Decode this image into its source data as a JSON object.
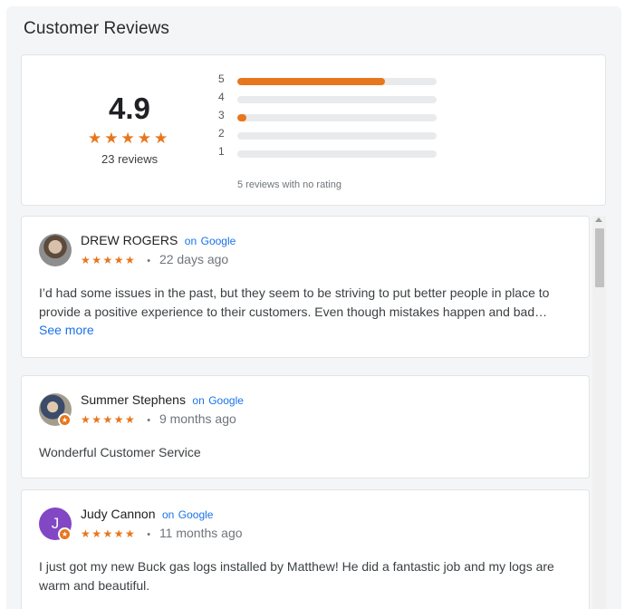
{
  "widget": {
    "title": "Customer Reviews"
  },
  "summary": {
    "rating": "4.9",
    "stars": "★★★★★",
    "review_count": "23 reviews",
    "no_rating_text": "5 reviews with no rating",
    "accent_color": "#e8761c",
    "distribution": [
      {
        "label": "5",
        "fraction": 0.74
      },
      {
        "label": "4",
        "fraction": 0.0
      },
      {
        "label": "3",
        "fraction": 0.045
      },
      {
        "label": "2",
        "fraction": 0.0
      },
      {
        "label": "1",
        "fraction": 0.0
      }
    ]
  },
  "reviews": [
    {
      "name": "DREW ROGERS",
      "on": "on",
      "source": "Google",
      "stars": "★★★★★",
      "separator": "•",
      "date": "22 days ago",
      "text": "I’d had some issues in the past, but they seem to be striving to put better people in place to provide a positive experience to their customers. Even though mistakes happen and bad…",
      "see_more": "See more",
      "avatar": "photo"
    },
    {
      "name": "Summer Stephens",
      "on": "on",
      "source": "Google",
      "stars": "★★★★★",
      "separator": "•",
      "date": "9 months ago",
      "text": "Wonderful Customer Service",
      "avatar": "photo",
      "badge_icon": "local-guide-star-icon"
    },
    {
      "name": "Judy Cannon",
      "on": "on",
      "source": "Google",
      "stars": "★★★★★",
      "separator": "•",
      "date": "11 months ago",
      "text": "I just got my new Buck gas logs installed by Matthew! He did a fantastic job and my logs are warm and beautiful.",
      "avatar_letter": "J",
      "avatar_color": "#8247c5",
      "badge_icon": "local-guide-star-icon"
    }
  ]
}
